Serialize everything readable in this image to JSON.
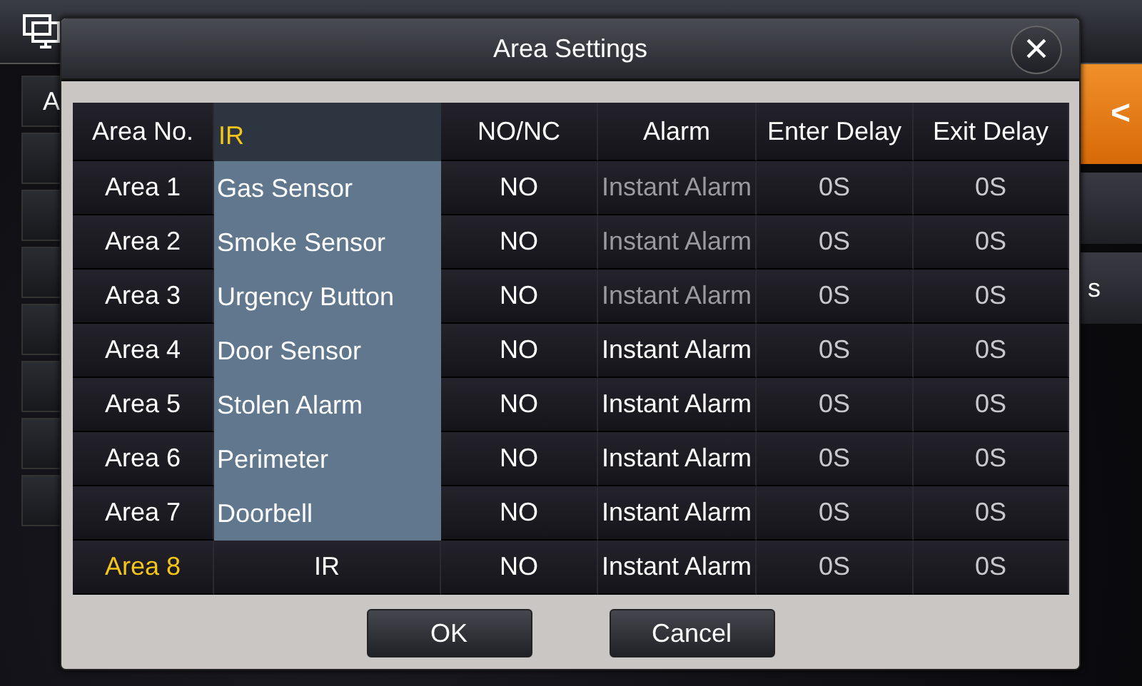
{
  "background": {
    "side_label": "A",
    "right_label": "s",
    "back_button": "<"
  },
  "dialog": {
    "title": "Area Settings",
    "close": "×",
    "table": {
      "columns": [
        {
          "label": "Area No."
        },
        {},
        {
          "label": "NO/NC"
        },
        {
          "label": "Alarm"
        },
        {
          "label": "Enter Delay"
        },
        {
          "label": "Exit Delay"
        }
      ],
      "rows": [
        {
          "area": "Area 1",
          "mode": "NO",
          "alarm": "Instant Alarm",
          "alarm_disabled": true,
          "enter": "0S",
          "exit": "0S",
          "selected": false
        },
        {
          "area": "Area 2",
          "mode": "NO",
          "alarm": "Instant Alarm",
          "alarm_disabled": true,
          "enter": "0S",
          "exit": "0S",
          "selected": false
        },
        {
          "area": "Area 3",
          "mode": "NO",
          "alarm": "Instant Alarm",
          "alarm_disabled": true,
          "enter": "0S",
          "exit": "0S",
          "selected": false
        },
        {
          "area": "Area 4",
          "mode": "NO",
          "alarm": "Instant Alarm",
          "alarm_disabled": false,
          "enter": "0S",
          "exit": "0S",
          "selected": false
        },
        {
          "area": "Area 5",
          "mode": "NO",
          "alarm": "Instant Alarm",
          "alarm_disabled": false,
          "enter": "0S",
          "exit": "0S",
          "selected": false
        },
        {
          "area": "Area 6",
          "mode": "NO",
          "alarm": "Instant Alarm",
          "alarm_disabled": false,
          "enter": "0S",
          "exit": "0S",
          "selected": false
        },
        {
          "area": "Area 7",
          "mode": "NO",
          "alarm": "Instant Alarm",
          "alarm_disabled": false,
          "enter": "0S",
          "exit": "0S",
          "selected": false
        },
        {
          "area": "Area 8",
          "type": "IR",
          "mode": "NO",
          "alarm": "Instant Alarm",
          "alarm_disabled": false,
          "enter": "0S",
          "exit": "0S",
          "selected": true
        }
      ]
    },
    "dropdown": {
      "options": [
        {
          "label": "IR",
          "selected": true
        },
        {
          "label": "Gas Sensor",
          "selected": false
        },
        {
          "label": "Smoke Sensor",
          "selected": false
        },
        {
          "label": "Urgency Button",
          "selected": false
        },
        {
          "label": "Door Sensor",
          "selected": false
        },
        {
          "label": "Stolen Alarm",
          "selected": false
        },
        {
          "label": "Perimeter",
          "selected": false
        },
        {
          "label": "Doorbell",
          "selected": false
        }
      ]
    },
    "buttons": [
      {
        "label": "OK"
      },
      {
        "label": "Cancel"
      }
    ]
  }
}
